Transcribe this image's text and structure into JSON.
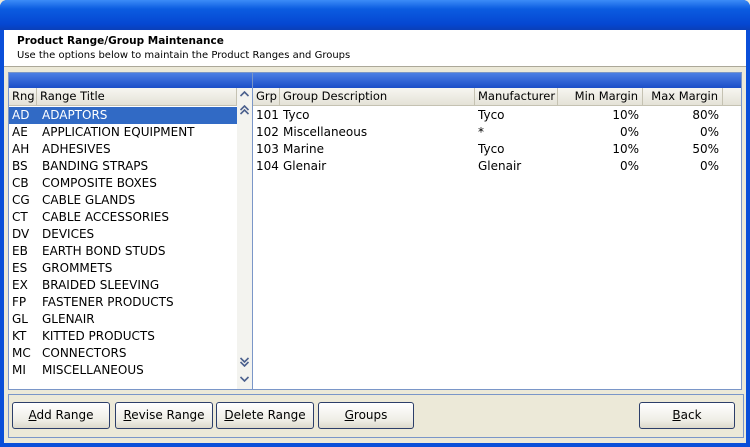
{
  "header": {
    "title": "Product Range/Group Maintenance",
    "subtitle": "Use the options below to maintain the Product Ranges and Groups"
  },
  "ranges": {
    "columns": [
      "Rng",
      "Range Title"
    ],
    "selected_index": 0,
    "rows": [
      {
        "code": "AD",
        "title": "ADAPTORS"
      },
      {
        "code": "AE",
        "title": "APPLICATION EQUIPMENT"
      },
      {
        "code": "AH",
        "title": "ADHESIVES"
      },
      {
        "code": "BS",
        "title": "BANDING STRAPS"
      },
      {
        "code": "CB",
        "title": "COMPOSITE BOXES"
      },
      {
        "code": "CG",
        "title": "CABLE GLANDS"
      },
      {
        "code": "CT",
        "title": "CABLE ACCESSORIES"
      },
      {
        "code": "DV",
        "title": "DEVICES"
      },
      {
        "code": "EB",
        "title": "EARTH BOND STUDS"
      },
      {
        "code": "ES",
        "title": "GROMMETS"
      },
      {
        "code": "EX",
        "title": "BRAIDED SLEEVING"
      },
      {
        "code": "FP",
        "title": "FASTENER PRODUCTS"
      },
      {
        "code": "GL",
        "title": "GLENAIR"
      },
      {
        "code": "KT",
        "title": "KITTED PRODUCTS"
      },
      {
        "code": "MC",
        "title": "CONNECTORS"
      },
      {
        "code": "MI",
        "title": "MISCELLANEOUS"
      }
    ]
  },
  "groups": {
    "columns": [
      "Grp",
      "Group Description",
      "Manufacturer",
      "Min Margin",
      "Max Margin"
    ],
    "rows": [
      {
        "grp": "101",
        "desc": "Tyco",
        "mfr": "Tyco",
        "min": "10%",
        "max": "80%"
      },
      {
        "grp": "102",
        "desc": "Miscellaneous",
        "mfr": "*",
        "min": "0%",
        "max": "0%"
      },
      {
        "grp": "103",
        "desc": "Marine",
        "mfr": "Tyco",
        "min": "10%",
        "max": "50%"
      },
      {
        "grp": "104",
        "desc": "Glenair",
        "mfr": "Glenair",
        "min": "0%",
        "max": "0%"
      }
    ]
  },
  "buttons": {
    "add": {
      "mnemonic": "A",
      "rest": "dd Range"
    },
    "revise": {
      "mnemonic": "R",
      "rest": "evise Range"
    },
    "delete": {
      "mnemonic": "D",
      "rest": "elete Range"
    },
    "groups": {
      "mnemonic": "G",
      "rest": "roups"
    },
    "back": {
      "mnemonic": "B",
      "rest": "ack"
    }
  },
  "icons": {
    "scroll_up": "up-arrow-icon",
    "scroll_down": "down-arrow-icon",
    "page_up": "double-up-arrow-icon",
    "page_down": "double-down-arrow-icon"
  },
  "colors": {
    "selection": "#316ac5",
    "panel_header": "#1b4ec7"
  }
}
